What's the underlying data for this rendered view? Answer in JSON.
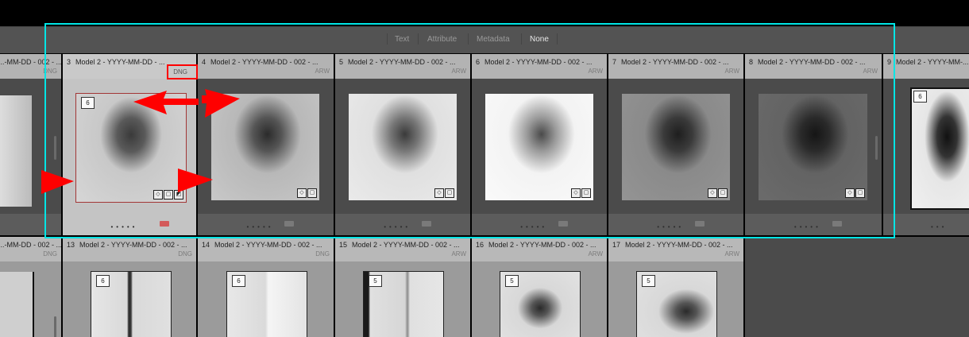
{
  "toolbar": {
    "items": [
      {
        "label": "Text",
        "active": false
      },
      {
        "label": "Attribute",
        "active": false
      },
      {
        "label": "Metadata",
        "active": false
      },
      {
        "label": "None",
        "active": true
      }
    ]
  },
  "grid": {
    "row1": [
      {
        "num": "",
        "title": "...-MM-DD - 002 - ...",
        "format": "DNG",
        "rating": "",
        "tone": "mid"
      },
      {
        "num": "3",
        "title": "Model 2 - YYYY-MM-DD - ...",
        "format": "DNG",
        "rating": "6",
        "tone": "mid",
        "selected": true
      },
      {
        "num": "4",
        "title": "Model 2 - YYYY-MM-DD - 002 - ...",
        "format": "ARW",
        "rating": "",
        "tone": "mid"
      },
      {
        "num": "5",
        "title": "Model 2 - YYYY-MM-DD - 002 - ...",
        "format": "ARW",
        "rating": "",
        "tone": "light"
      },
      {
        "num": "6",
        "title": "Model 2 - YYYY-MM-DD - 002 - ...",
        "format": "ARW",
        "rating": "",
        "tone": "lightest"
      },
      {
        "num": "7",
        "title": "Model 2 - YYYY-MM-DD - 002 - ...",
        "format": "ARW",
        "rating": "",
        "tone": "dark"
      },
      {
        "num": "8",
        "title": "Model 2 - YYYY-MM-DD - 002 - ...",
        "format": "ARW",
        "rating": "",
        "tone": "darker"
      },
      {
        "num": "9",
        "title": "Model 2 - YYYY-MM-...",
        "format": "",
        "rating": "6",
        "tone": "inverted"
      }
    ],
    "row2": [
      {
        "num": "",
        "title": "...-MM-DD - 002 - ...",
        "format": "DNG",
        "rating": ""
      },
      {
        "num": "13",
        "title": "Model 2 - YYYY-MM-DD - 002 - ...",
        "format": "DNG",
        "rating": "6"
      },
      {
        "num": "14",
        "title": "Model 2 - YYYY-MM-DD - 002 - ...",
        "format": "DNG",
        "rating": "6"
      },
      {
        "num": "15",
        "title": "Model 2 - YYYY-MM-DD - 002 - ...",
        "format": "ARW",
        "rating": "5"
      },
      {
        "num": "16",
        "title": "Model 2 - YYYY-MM-DD - 002 - ...",
        "format": "ARW",
        "rating": "5"
      },
      {
        "num": "17",
        "title": "Model 2 - YYYY-MM-DD - 002 - ...",
        "format": "ARW",
        "rating": "5"
      }
    ]
  },
  "annotation_color": "#ff0000",
  "highlight_color": "#00e5e5"
}
